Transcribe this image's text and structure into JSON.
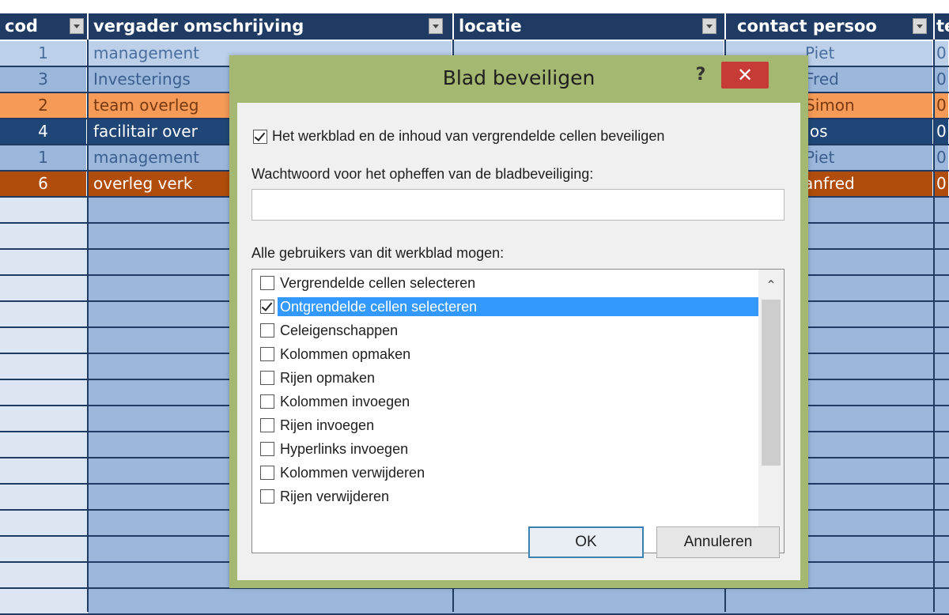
{
  "sheet": {
    "headers": [
      {
        "label": "cod"
      },
      {
        "label": "vergader omschrijving"
      },
      {
        "label": "locatie"
      },
      {
        "label": "contact persoo"
      },
      {
        "label": "te"
      }
    ],
    "rows": [
      {
        "code": "1",
        "omschrijving": "management",
        "contact": "Piet",
        "tel": "0",
        "bg": "#bcd0ea",
        "fg": "#4a6f9e"
      },
      {
        "code": "3",
        "omschrijving": "Investerings",
        "contact": "Fred",
        "tel": "0",
        "bg": "#9bb8dc",
        "fg": "#3d5f8e"
      },
      {
        "code": "2",
        "omschrijving": "team overleg",
        "contact": "Simon",
        "tel": "0",
        "bg": "#f59a57",
        "fg": "#7a3a10"
      },
      {
        "code": "4",
        "omschrijving": "facilitair over",
        "contact": "Jos",
        "tel": "0",
        "bg": "#1f4677",
        "fg": "#ffffff"
      },
      {
        "code": "1",
        "omschrijving": "management",
        "contact": "Piet",
        "tel": "0",
        "bg": "#9bb8dc",
        "fg": "#3d5f8e"
      },
      {
        "code": "6",
        "omschrijving": "overleg verk",
        "contact": "anfred",
        "tel": "0",
        "bg": "#b04d0c",
        "fg": "#ffffff"
      }
    ],
    "header_color": "#1f3b63"
  },
  "dialog": {
    "title": "Blad beveiligen",
    "help_label": "?",
    "close_label": "✕",
    "protect_checkbox_label": "Het werkblad en de inhoud van vergrendelde cellen beveiligen",
    "protect_checked": true,
    "password_label": "Wachtwoord voor het opheffen van de bladbeveiliging:",
    "password_value": "",
    "permissions_label": "Alle gebruikers van dit werkblad mogen:",
    "permissions": [
      {
        "label": "Vergrendelde cellen selecteren",
        "checked": false
      },
      {
        "label": "Ontgrendelde cellen selecteren",
        "checked": true,
        "selected": true
      },
      {
        "label": "Celeigenschappen",
        "checked": false
      },
      {
        "label": "Kolommen opmaken",
        "checked": false
      },
      {
        "label": "Rijen opmaken",
        "checked": false
      },
      {
        "label": "Kolommen invoegen",
        "checked": false
      },
      {
        "label": "Rijen invoegen",
        "checked": false
      },
      {
        "label": "Hyperlinks invoegen",
        "checked": false
      },
      {
        "label": "Kolommen verwijderen",
        "checked": false
      },
      {
        "label": "Rijen verwijderen",
        "checked": false
      }
    ],
    "ok_label": "OK",
    "cancel_label": "Annuleren",
    "frame_color": "#a5b872",
    "close_color": "#c73b36",
    "selection_color": "#3399ff"
  }
}
